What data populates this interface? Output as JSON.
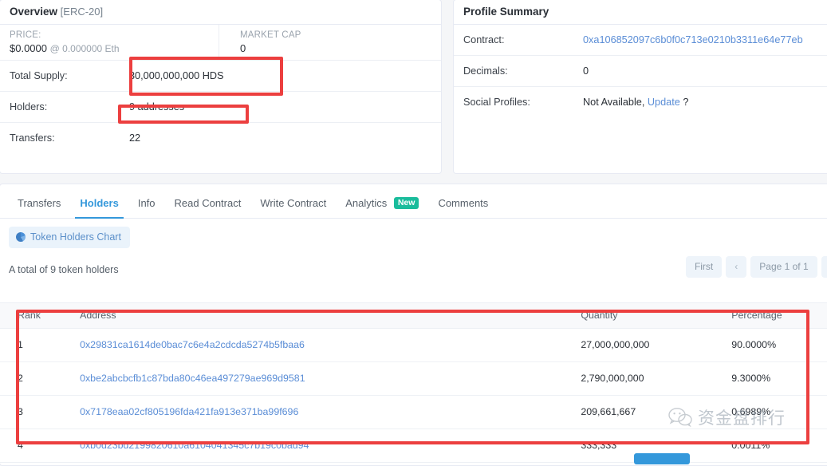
{
  "overview": {
    "title": "Overview",
    "subtitle": "[ERC-20]",
    "price_label": "PRICE:",
    "price_value": "$0.0000",
    "price_suffix": "@ 0.000000 Eth",
    "market_cap_label": "MARKET CAP",
    "market_cap_value": "0",
    "rows": [
      {
        "label": "Total Supply:",
        "value": "30,000,000,000 HDS"
      },
      {
        "label": "Holders:",
        "value": "9 addresses"
      },
      {
        "label": "Transfers:",
        "value": "22"
      }
    ]
  },
  "profile": {
    "title": "Profile Summary",
    "contract_label": "Contract:",
    "contract_value": "0xa106852097c6b0f0c713e0210b3311e64e77eb",
    "decimals_label": "Decimals:",
    "decimals_value": "0",
    "social_label": "Social Profiles:",
    "social_value": "Not Available,",
    "social_link": "Update",
    "social_suffix": "?"
  },
  "tabs": [
    {
      "label": "Transfers",
      "badge": ""
    },
    {
      "label": "Holders",
      "badge": ""
    },
    {
      "label": "Info",
      "badge": ""
    },
    {
      "label": "Read Contract",
      "badge": ""
    },
    {
      "label": "Write Contract",
      "badge": ""
    },
    {
      "label": "Analytics",
      "badge": "New"
    },
    {
      "label": "Comments",
      "badge": ""
    }
  ],
  "holders_panel": {
    "chart_button": "Token Holders Chart",
    "total_line": "A total of 9 token holders",
    "pager": {
      "first": "First",
      "prev": "‹",
      "page_info": "Page 1 of 1"
    },
    "columns": [
      "Rank",
      "Address",
      "Quantity",
      "Percentage"
    ],
    "rows": [
      {
        "rank": "1",
        "address": "0x29831ca1614de0bac7c6e4a2cdcda5274b5fbaa6",
        "quantity": "27,000,000,000",
        "percentage": "90.0000%"
      },
      {
        "rank": "2",
        "address": "0xbe2abcbcfb1c87bda80c46ea497279ae969d9581",
        "quantity": "2,790,000,000",
        "percentage": "9.3000%"
      },
      {
        "rank": "3",
        "address": "0x7178eaa02cf805196fda421fa913e371ba99f696",
        "quantity": "209,661,667",
        "percentage": "0.6989%"
      },
      {
        "rank": "4",
        "address": "0xb0d23bd2199820610a6104041345c7b19c0bad94",
        "quantity": "333,333",
        "percentage": "0.0011%"
      }
    ]
  },
  "watermark": {
    "text": "资金盘排行"
  },
  "colors": {
    "accent": "#3498db",
    "link": "#5a8dd6",
    "badge_new": "#1abc9c",
    "annotation": "#ec3f3f"
  }
}
